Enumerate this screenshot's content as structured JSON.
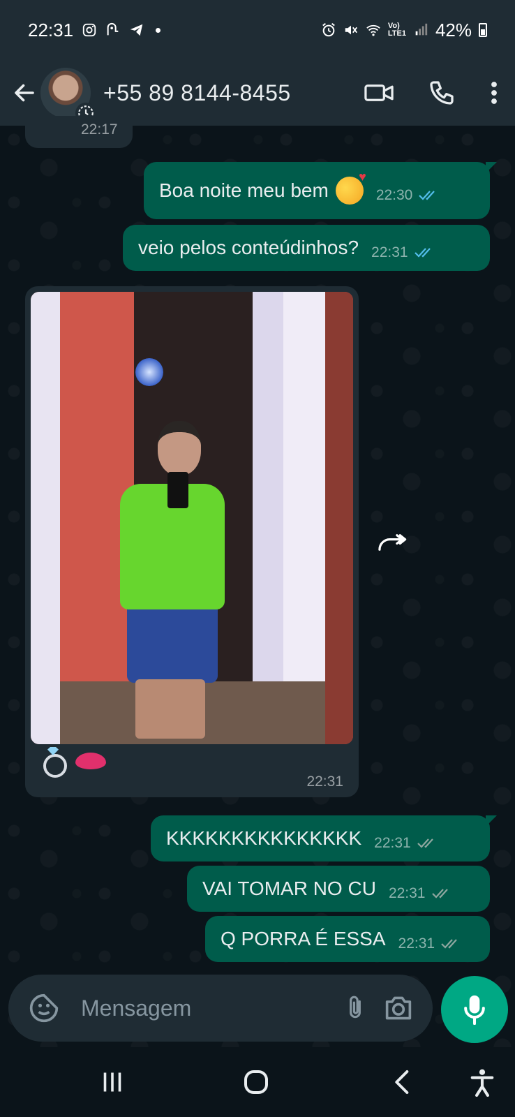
{
  "status_bar": {
    "time": "22:31",
    "network": "Vo)\nLTE1",
    "battery": "42%"
  },
  "header": {
    "contact_name": "+55 89 8144-8455",
    "icons": [
      "back-arrow-icon",
      "video-call-icon",
      "phone-icon",
      "more-vert-icon"
    ]
  },
  "messages": {
    "prev_time": "22:17",
    "m1": {
      "text": "Boa noite meu bem",
      "time": "22:30"
    },
    "m2": {
      "text": "veio pelos conteúdinhos?",
      "time": "22:31"
    },
    "photo": {
      "time": "22:31"
    },
    "m3": {
      "text": "KKKKKKKKKKKKKKK",
      "time": "22:31"
    },
    "m4": {
      "text": "VAI TOMAR NO CU",
      "time": "22:31"
    },
    "m5": {
      "text": "Q PORRA É ESSA",
      "time": "22:31"
    }
  },
  "input": {
    "placeholder": "Mensagem"
  },
  "colors": {
    "outgoing_bubble": "#005c4b",
    "incoming_bubble": "#1f2c34",
    "header_bg": "#1f2c34",
    "chat_bg": "#0b141a",
    "read_ticks": "#53bdeb",
    "mic_button": "#00a884"
  }
}
